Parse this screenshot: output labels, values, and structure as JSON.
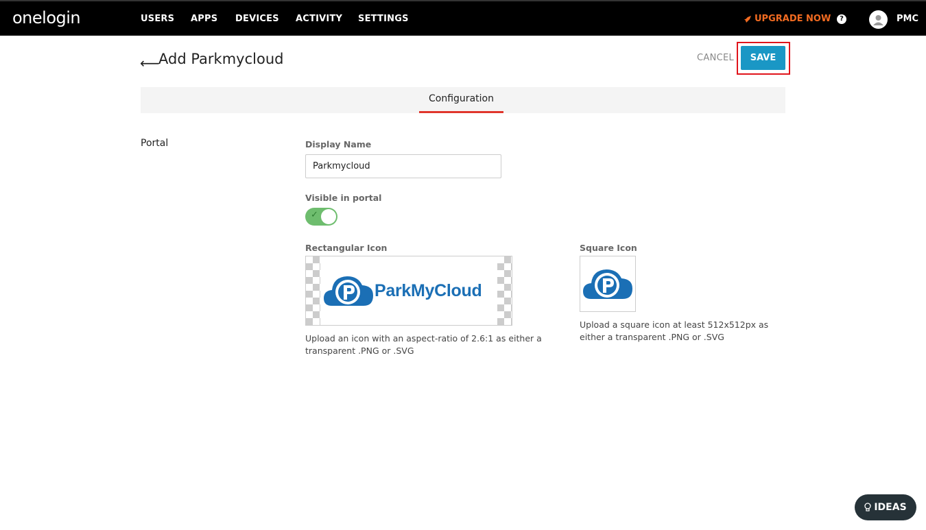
{
  "nav": {
    "logo": "onelogin",
    "items": [
      {
        "label": "USERS"
      },
      {
        "label": "APPS"
      },
      {
        "label": "DEVICES"
      },
      {
        "label": "ACTIVITY"
      },
      {
        "label": "SETTINGS"
      }
    ],
    "upgrade_label": "UPGRADE NOW",
    "help_glyph": "?",
    "user_name": "PMC"
  },
  "header": {
    "back_glyph": "⟵",
    "title": "Add Parkmycloud",
    "cancel_label": "CANCEL",
    "save_label": "SAVE"
  },
  "tabs": [
    {
      "label": "Configuration",
      "active": true
    }
  ],
  "form": {
    "section_label": "Portal",
    "display_name": {
      "label": "Display Name",
      "value": "Parkmycloud"
    },
    "visible_in_portal": {
      "label": "Visible in portal",
      "on": true
    },
    "rect_icon": {
      "label": "Rectangular Icon",
      "logo_text": "ParkMyCloud",
      "help": "Upload an icon with an aspect-ratio of 2.6:1 as either a transparent .PNG or .SVG"
    },
    "square_icon": {
      "label": "Square Icon",
      "help": "Upload a square icon at least 512x512px as either a transparent .PNG or .SVG"
    }
  },
  "ideas_label": "IDEAS",
  "colors": {
    "accent": "#1a97c5",
    "upgrade": "#f26b21",
    "tab_underline": "#e0352b",
    "toggle_on": "#6ebd6e",
    "brand_blue": "#1b6fb5"
  }
}
